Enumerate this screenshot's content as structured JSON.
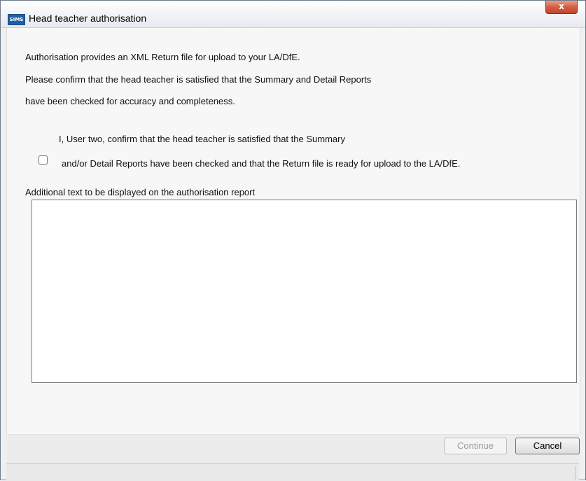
{
  "window": {
    "app_icon_text": "SIMS",
    "title": "Head teacher authorisation",
    "close_label": "x"
  },
  "content": {
    "intro_line": "Authorisation provides an XML Return file for upload to your LA/DfE.",
    "confirm_line_1": "Please confirm that the head teacher is satisfied that the Summary and Detail Reports",
    "confirm_line_2": "have been checked for accuracy and completeness.",
    "checkbox": {
      "checked": false,
      "label_line_1": "I, User two, confirm that the head teacher is satisfied that the Summary",
      "label_line_2": "and/or Detail Reports have been checked and that the Return file is ready for upload to the LA/DfE."
    },
    "additional_text_label": "Additional text to be displayed on the authorisation report",
    "additional_text_value": ""
  },
  "footer": {
    "continue_label": "Continue",
    "continue_enabled": false,
    "cancel_label": "Cancel"
  }
}
